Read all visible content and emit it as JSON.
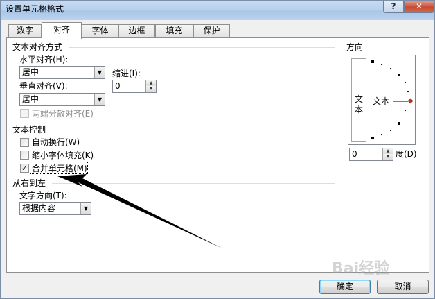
{
  "window": {
    "title": "设置单元格格式",
    "help_label": "?",
    "close_label": "✕"
  },
  "tabs": [
    {
      "label": "数字",
      "active": false
    },
    {
      "label": "对齐",
      "active": true
    },
    {
      "label": "字体",
      "active": false
    },
    {
      "label": "边框",
      "active": false
    },
    {
      "label": "填充",
      "active": false
    },
    {
      "label": "保护",
      "active": false
    }
  ],
  "alignment": {
    "section_title": "文本对齐方式",
    "horizontal_label": "水平对齐(H):",
    "horizontal_value": "居中",
    "indent_label": "缩进(I):",
    "indent_value": "0",
    "vertical_label": "垂直对齐(V):",
    "vertical_value": "居中",
    "distributed_label": "两端分散对齐(E)",
    "distributed_checked": false
  },
  "text_control": {
    "section_title": "文本控制",
    "wrap_label": "自动换行(W)",
    "wrap_checked": false,
    "shrink_label": "缩小字体填充(K)",
    "shrink_checked": false,
    "merge_label": "合并单元格(M)",
    "merge_checked": true,
    "check_mark": "✓"
  },
  "rtl": {
    "section_title": "从右到左",
    "direction_label": "文字方向(T):",
    "direction_value": "根据内容"
  },
  "orientation": {
    "section_title": "方向",
    "vertical_text_1": "文",
    "vertical_text_2": "本",
    "dial_text": "文本",
    "degrees_value": "0",
    "degrees_label": "度(D)",
    "angle_degrees": 0,
    "marker_color": "#c0392b"
  },
  "buttons": {
    "ok_label": "确定",
    "cancel_label": "取消"
  },
  "watermark": "Bai经验"
}
